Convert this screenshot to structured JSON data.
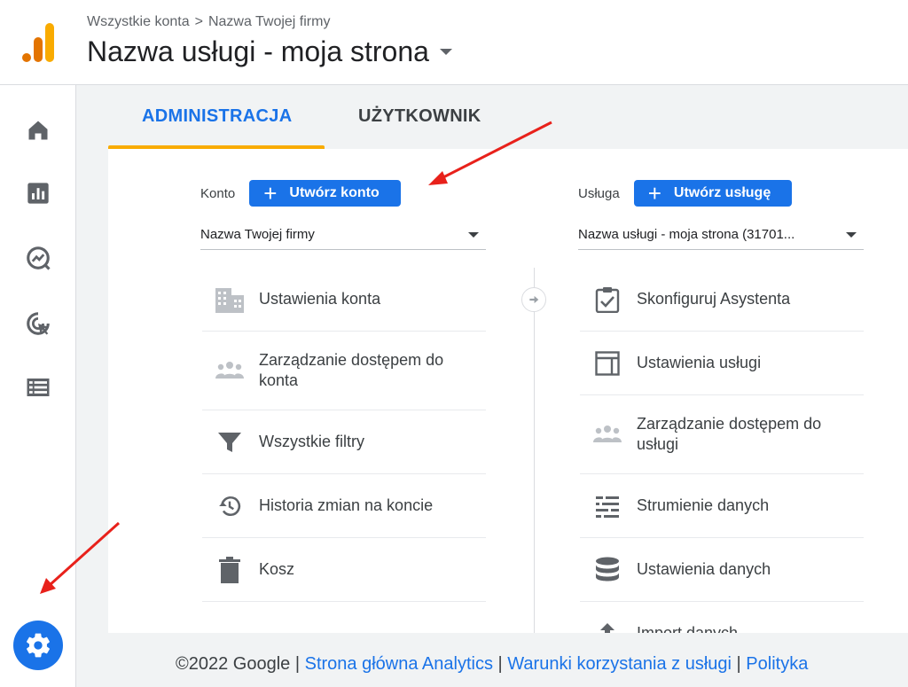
{
  "header": {
    "breadcrumb": [
      "Wszystkie konta",
      "Nazwa Twojej firmy"
    ],
    "breadcrumb_sep": ">",
    "property_title": "Nazwa usługi - moja strona"
  },
  "nav": {
    "items": [
      "home-icon",
      "reports-icon",
      "explore-icon",
      "advertising-icon",
      "configure-icon"
    ],
    "settings_icon": "gear-icon"
  },
  "tabs": {
    "admin": "ADMINISTRACJA",
    "user": "UŻYTKOWNIK",
    "active": "ADMINISTRACJA"
  },
  "account": {
    "label": "Konto",
    "create_button": "Utwórz konto",
    "selected": "Nazwa Twojej firmy",
    "items": [
      {
        "icon": "building-icon",
        "label": "Ustawienia konta"
      },
      {
        "icon": "people-icon",
        "label": "Zarządzanie dostępem do konta"
      },
      {
        "icon": "filter-icon",
        "label": "Wszystkie filtry"
      },
      {
        "icon": "history-icon",
        "label": "Historia zmian na koncie"
      },
      {
        "icon": "trash-icon",
        "label": "Kosz"
      }
    ]
  },
  "property": {
    "label": "Usługa",
    "create_button": "Utwórz usługę",
    "selected": "Nazwa usługi - moja strona (31701...",
    "items": [
      {
        "icon": "clipboard-check-icon",
        "label": "Skonfiguruj Asystenta"
      },
      {
        "icon": "layout-icon",
        "label": "Ustawienia usługi"
      },
      {
        "icon": "people-icon",
        "label": "Zarządzanie dostępem do usługi"
      },
      {
        "icon": "data-streams-icon",
        "label": "Strumienie danych"
      },
      {
        "icon": "database-icon",
        "label": "Ustawienia danych"
      },
      {
        "icon": "upload-icon",
        "label": "Import danych"
      }
    ]
  },
  "footer": {
    "copyright": "©2022 Google",
    "links": [
      "Strona główna Analytics",
      "Warunki korzystania z usługi",
      "Polityka"
    ],
    "separator": "|"
  },
  "colors": {
    "accent": "#1a73e8",
    "tab_underline": "#f9ab00",
    "logo_orange": "#f9ab00",
    "logo_dark": "#e37400",
    "annotation": "#e8211b"
  }
}
